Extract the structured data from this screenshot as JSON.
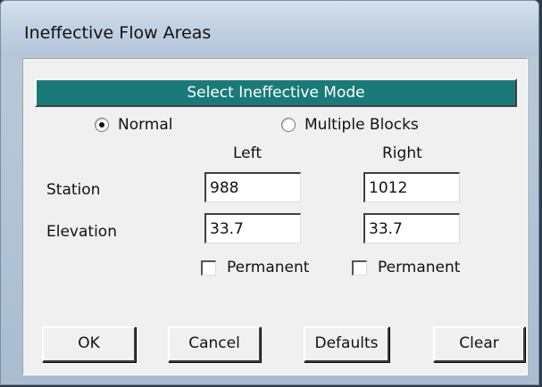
{
  "window": {
    "title": "Ineffective Flow Areas"
  },
  "mode": {
    "header": "Select Ineffective Mode",
    "options": [
      {
        "label": "Normal",
        "selected": true
      },
      {
        "label": "Multiple Blocks",
        "selected": false
      }
    ]
  },
  "columns": {
    "left": "Left",
    "right": "Right"
  },
  "rows": {
    "station": {
      "label": "Station",
      "left": "988",
      "right": "1012"
    },
    "elevation": {
      "label": "Elevation",
      "left": "33.7",
      "right": "33.7"
    }
  },
  "permanent": {
    "left": {
      "label": "Permanent",
      "checked": false
    },
    "right": {
      "label": "Permanent",
      "checked": false
    }
  },
  "buttons": {
    "ok": "OK",
    "cancel": "Cancel",
    "defaults": "Defaults",
    "clear": "Clear"
  },
  "colors": {
    "header_bg": "#1a7a7a",
    "dialog_bg": "#f0f0f0"
  }
}
